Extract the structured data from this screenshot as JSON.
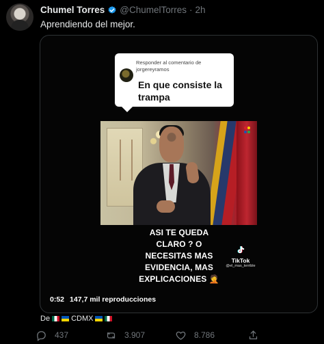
{
  "tweet": {
    "name": "Chumel Torres",
    "handle": "@ChumelTorres",
    "separator": "·",
    "time": "2h",
    "text": "Aprendiendo del mejor."
  },
  "media": {
    "reply_title": "Responder al comentario de jorgereyramos",
    "reply_text": "En que consiste la trampa",
    "caption": "ASI TE QUEDA CLARO ? O NECESITAS MAS EVIDENCIA, MAS EXPLICACIONES 🤦",
    "tiktok_word": "TikTok",
    "tiktok_user": "@el_mas_terrible",
    "duration": "0:52",
    "views": "147,7 mil reproducciones"
  },
  "location": {
    "prefix": "De",
    "middle": "CDMX"
  },
  "actions": {
    "replies": "437",
    "retweets": "3.907",
    "likes": "8.786"
  },
  "colors": {
    "background": "#000000",
    "text": "#e7e9ea",
    "muted": "#71767b",
    "verified": "#1d9bf0"
  },
  "icons": [
    "verified-icon",
    "reply-icon",
    "retweet-icon",
    "like-icon",
    "share-icon",
    "tiktok-icon",
    "mexico-flag-icon",
    "ukraine-flag-icon"
  ]
}
